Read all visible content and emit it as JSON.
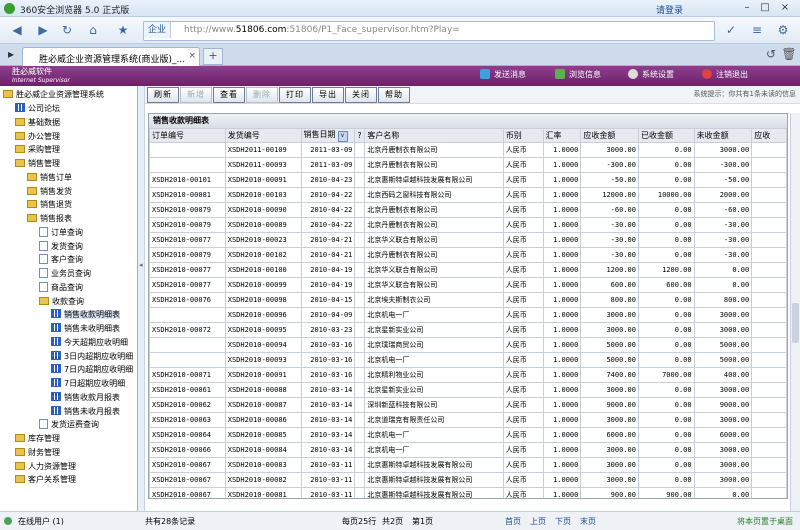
{
  "browser": {
    "title": "360安全浏览器 5.0 正式版",
    "login": "请登录",
    "mode": "企业",
    "url_prefix": "http://www.",
    "url_domain": "51806.com",
    "url_rest": ":51806/P1_Face_supervisor.htm?Play=",
    "tab_title": "胜必威企业资源管理系统(商业版)_...",
    "new_tab": "+"
  },
  "app": {
    "brand_cn": "胜必威软件",
    "brand_en": "Internet Supervisor",
    "header_buttons": [
      {
        "label": "发送消息",
        "icon": "send-message-icon"
      },
      {
        "label": "浏览信息",
        "icon": "view-message-icon"
      },
      {
        "label": "系统设置",
        "icon": "gear-icon"
      },
      {
        "label": "注销退出",
        "icon": "logout-icon"
      }
    ]
  },
  "tree": {
    "root": "胜必威企业资源管理系统",
    "items": [
      {
        "label": "公司论坛",
        "icon": "grid"
      },
      {
        "label": "基础数据",
        "icon": "folder"
      },
      {
        "label": "办公管理",
        "icon": "folder"
      },
      {
        "label": "采购管理",
        "icon": "folder"
      },
      {
        "label": "销售管理",
        "icon": "folder"
      },
      {
        "label": "销售订单",
        "icon": "folder"
      },
      {
        "label": "销售发货",
        "icon": "folder"
      },
      {
        "label": "销售退货",
        "icon": "folder"
      },
      {
        "label": "销售报表",
        "icon": "folder"
      },
      {
        "label": "订单查询",
        "icon": "doc"
      },
      {
        "label": "发货查询",
        "icon": "doc"
      },
      {
        "label": "客户查询",
        "icon": "doc"
      },
      {
        "label": "业务员查询",
        "icon": "doc"
      },
      {
        "label": "商品查询",
        "icon": "doc"
      },
      {
        "label": "收款查询",
        "icon": "folder"
      },
      {
        "label": "销售收款明细表",
        "icon": "grid"
      },
      {
        "label": "销售未收明细表",
        "icon": "grid"
      },
      {
        "label": "今天超期应收明细",
        "icon": "grid"
      },
      {
        "label": "3日内超期应收明细",
        "icon": "grid"
      },
      {
        "label": "7日内超期应收明细",
        "icon": "grid"
      },
      {
        "label": "7日超期应收明细",
        "icon": "grid"
      },
      {
        "label": "销售收款月报表",
        "icon": "grid"
      },
      {
        "label": "销售未收月报表",
        "icon": "grid"
      },
      {
        "label": "发货运费查询",
        "icon": "doc"
      },
      {
        "label": "库存管理",
        "icon": "folder"
      },
      {
        "label": "财务管理",
        "icon": "folder"
      },
      {
        "label": "人力资源管理",
        "icon": "folder"
      },
      {
        "label": "客户关系管理",
        "icon": "folder"
      }
    ]
  },
  "toolbar": {
    "buttons": [
      {
        "label": "刷新",
        "disabled": false
      },
      {
        "label": "新增",
        "disabled": true
      },
      {
        "label": "查看",
        "disabled": false
      },
      {
        "label": "删除",
        "disabled": true
      },
      {
        "label": "打印",
        "disabled": false
      },
      {
        "label": "导出",
        "disabled": false
      },
      {
        "label": "关闭",
        "disabled": false
      },
      {
        "label": "帮助",
        "disabled": false
      }
    ],
    "hint": "系统提示：你共有1条未读的信息"
  },
  "report": {
    "title": "销售收款明细表",
    "sort_arrow": "∨",
    "columns": [
      "订单编号",
      "发货编号",
      "销售日期",
      "?",
      "客户名称",
      "币别",
      "汇率",
      "应收金额",
      "已收金额",
      "未收金额",
      "应收"
    ],
    "rows": [
      [
        "",
        "XSDH2011-00109",
        "2011-03-09",
        "北京丹鹿制衣有限公司",
        "人民币",
        "1.0000",
        "3000.00",
        "0.00",
        "3000.00"
      ],
      [
        "",
        "XSDH2011-00093",
        "2011-03-09",
        "北京丹鹿制衣有限公司",
        "人民币",
        "1.0000",
        "-300.00",
        "0.00",
        "-300.00"
      ],
      [
        "XSDH2010-00101",
        "XSDH2010-00091",
        "2010-04-23",
        "北京惠斯特卓越科技发展有限公司",
        "人民币",
        "1.0000",
        "-50.00",
        "0.00",
        "-50.00"
      ],
      [
        "XSDH2010-00081",
        "XSDH2010-00103",
        "2010-04-22",
        "北京西码之窗科技有限公司",
        "人民币",
        "1.0000",
        "12000.00",
        "10000.00",
        "2000.00"
      ],
      [
        "XSDH2010-00079",
        "XSDH2010-00090",
        "2010-04-22",
        "北京丹鹿制衣有限公司",
        "人民币",
        "1.0000",
        "-60.00",
        "0.00",
        "-60.00"
      ],
      [
        "XSDH2010-00079",
        "XSDH2010-00089",
        "2010-04-22",
        "北京丹鹿制衣有限公司",
        "人民币",
        "1.0000",
        "-30.00",
        "0.00",
        "-30.00"
      ],
      [
        "XSDH2010-00077",
        "XSDH2010-00023",
        "2010-04-21",
        "北京华义联合有限公司",
        "人民币",
        "1.0000",
        "-30.00",
        "0.00",
        "-30.00"
      ],
      [
        "XSDH2010-00079",
        "XSDH2010-00102",
        "2010-04-21",
        "北京丹鹿制衣有限公司",
        "人民币",
        "1.0000",
        "-30.00",
        "0.00",
        "-30.00"
      ],
      [
        "XSDH2010-00077",
        "XSDH2010-00100",
        "2010-04-19",
        "北京华义联合有限公司",
        "人民币",
        "1.0000",
        "1200.00",
        "1200.00",
        "0.00"
      ],
      [
        "XSDH2010-00077",
        "XSDH2010-00099",
        "2010-04-19",
        "北京华义联合有限公司",
        "人民币",
        "1.0000",
        "600.00",
        "600.00",
        "0.00"
      ],
      [
        "XSDH2010-00076",
        "XSDH2010-00098",
        "2010-04-15",
        "北京埃夫斯制衣公司",
        "人民币",
        "1.0000",
        "800.00",
        "0.00",
        "800.00"
      ],
      [
        "",
        "XSDH2010-00096",
        "2010-04-09",
        "北京机电一厂",
        "人民币",
        "1.0000",
        "3000.00",
        "0.00",
        "3000.00"
      ],
      [
        "XSDH2010-00072",
        "XSDH2010-00095",
        "2010-03-23",
        "北京星新实业公司",
        "人民币",
        "1.0000",
        "3000.00",
        "0.00",
        "3000.00"
      ],
      [
        "",
        "XSDH2010-00094",
        "2010-03-16",
        "北京璞瑞商贸公司",
        "人民币",
        "1.0000",
        "5000.00",
        "0.00",
        "5000.00"
      ],
      [
        "",
        "XSDH2010-00093",
        "2010-03-16",
        "北京机电一厂",
        "人民币",
        "1.0000",
        "5000.00",
        "0.00",
        "5000.00"
      ],
      [
        "XSDH2010-00071",
        "XSDH2010-00091",
        "2010-03-16",
        "北京精利物业公司",
        "人民币",
        "1.0000",
        "7400.00",
        "7000.00",
        "400.00"
      ],
      [
        "XSDH2010-00061",
        "XSDH2010-00088",
        "2010-03-14",
        "北京星新实业公司",
        "人民币",
        "1.0000",
        "3000.00",
        "0.00",
        "3000.00"
      ],
      [
        "XSDH2010-00062",
        "XSDH2010-00087",
        "2010-03-14",
        "深圳新蓝科技有限公司",
        "人民币",
        "1.0000",
        "9000.00",
        "0.00",
        "9000.00"
      ],
      [
        "XSDH2010-00063",
        "XSDH2010-00086",
        "2010-03-14",
        "北京道瑞克有限责任公司",
        "人民币",
        "1.0000",
        "3000.00",
        "0.00",
        "3000.00"
      ],
      [
        "XSDH2010-00064",
        "XSDH2010-00085",
        "2010-03-14",
        "北京机电一厂",
        "人民币",
        "1.0000",
        "6000.00",
        "0.00",
        "6000.00"
      ],
      [
        "XSDH2010-00066",
        "XSDH2010-00084",
        "2010-03-14",
        "北京机电一厂",
        "人民币",
        "1.0000",
        "3000.00",
        "0.00",
        "3000.00"
      ],
      [
        "XSDH2010-00067",
        "XSDH2010-00083",
        "2010-03-11",
        "北京惠斯特卓越科技发展有限公司",
        "人民币",
        "1.0000",
        "3000.00",
        "0.00",
        "3000.00"
      ],
      [
        "XSDH2010-00067",
        "XSDH2010-00082",
        "2010-03-11",
        "北京惠斯特卓越科技发展有限公司",
        "人民币",
        "1.0000",
        "3000.00",
        "0.00",
        "3000.00"
      ],
      [
        "XSDH2010-00067",
        "XSDH2010-00081",
        "2010-03-11",
        "北京惠斯特卓越科技发展有限公司",
        "人民币",
        "1.0000",
        "900.00",
        "900.00",
        "0.00"
      ],
      [
        "XSDH2010-00069",
        "XSDH2010-00020",
        "2010-03-09",
        "北京机电一厂",
        "人民币",
        "1.0000",
        "-7500.00",
        "0.00",
        "-7500.00"
      ]
    ]
  },
  "footer": {
    "status": "在线用户 (1)",
    "total": "共有28条记录",
    "page_size": "每页25行",
    "page_count": "共2页",
    "current": "第1页",
    "first": "首页",
    "prev": "上页",
    "next": "下页",
    "last": "末页",
    "save": "将本页置于桌面"
  },
  "colors": {
    "header": "#7a2c78",
    "selected": "#dbe6f6"
  }
}
